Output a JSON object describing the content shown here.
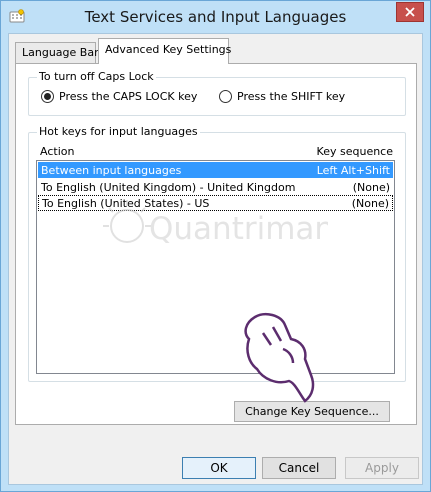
{
  "window": {
    "title": "Text Services and Input Languages",
    "close_icon": "close-icon"
  },
  "tabs": [
    {
      "label": "Language Bar",
      "active": false
    },
    {
      "label": "Advanced Key Settings",
      "active": true
    }
  ],
  "caps_lock": {
    "legend": "To turn off Caps Lock",
    "options": [
      {
        "label": "Press the CAPS LOCK key",
        "checked": true
      },
      {
        "label": "Press the SHIFT key",
        "checked": false
      }
    ]
  },
  "hotkeys": {
    "legend": "Hot keys for input languages",
    "columns": {
      "action": "Action",
      "sequence": "Key sequence"
    },
    "rows": [
      {
        "action": "Between input languages",
        "sequence": "Left Alt+Shift",
        "selected": true
      },
      {
        "action": "To English (United Kingdom) - United Kingdom",
        "sequence": "(None)",
        "selected": false
      },
      {
        "action": "To English (United States) - US",
        "sequence": "(None)",
        "selected": false
      }
    ],
    "change_button": "Change Key Sequence..."
  },
  "buttons": {
    "ok": "OK",
    "cancel": "Cancel",
    "apply": "Apply"
  },
  "watermark": {
    "text": "Quantrimang"
  },
  "colors": {
    "title_bar": "#bfe0f7",
    "selection": "#3399ff",
    "close": "#c7504c"
  }
}
